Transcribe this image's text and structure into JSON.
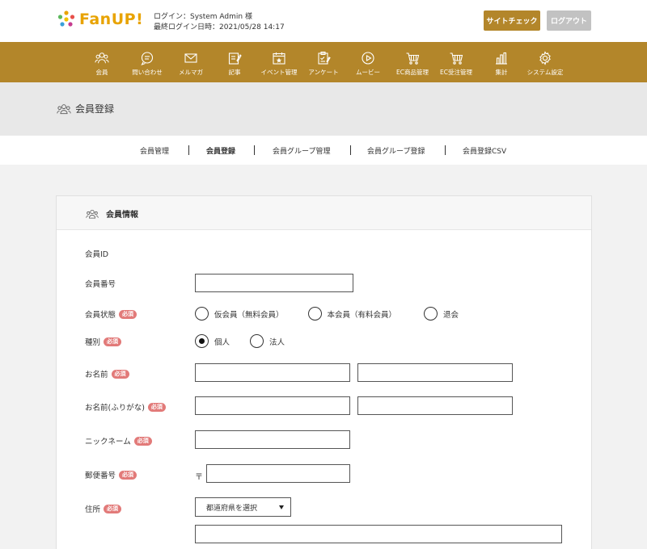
{
  "header": {
    "logo_text": "FanUP!",
    "login_line": "ログイン：System Admin 様",
    "last_login_line": "最終ログイン日時：2021/05/28 14:17",
    "site_check_label": "サイトチェック",
    "logout_label": "ログアウト"
  },
  "nav": {
    "items": [
      {
        "label": "会員",
        "icon": "members-icon"
      },
      {
        "label": "問い合わせ",
        "icon": "chat-icon"
      },
      {
        "label": "メルマガ",
        "icon": "mail-icon"
      },
      {
        "label": "記事",
        "icon": "article-icon"
      },
      {
        "label": "イベント管理",
        "icon": "event-icon"
      },
      {
        "label": "アンケート",
        "icon": "survey-icon"
      },
      {
        "label": "ムービー",
        "icon": "movie-icon"
      },
      {
        "label": "EC商品管理",
        "icon": "cart-icon"
      },
      {
        "label": "EC受注管理",
        "icon": "cart-icon"
      },
      {
        "label": "集計",
        "icon": "bar-chart-icon"
      },
      {
        "label": "システム設定",
        "icon": "gear-icon"
      }
    ]
  },
  "page": {
    "title": "会員登録"
  },
  "subnav": {
    "items": [
      "会員管理",
      "会員登録",
      "会員グループ管理",
      "会員グループ登録",
      "会員登録CSV"
    ],
    "active": "会員登録"
  },
  "form": {
    "section_title": "会員情報",
    "required_badge": "必須",
    "member_id_label": "会員ID",
    "member_number_label": "会員番号",
    "member_status_label": "会員状態",
    "member_status_options": [
      "仮会員（無料会員）",
      "本会員（有料会員）",
      "退会"
    ],
    "type_label": "種別",
    "type_options": [
      "個人",
      "法人"
    ],
    "type_selected": "個人",
    "name_label": "お名前",
    "name_kana_label": "お名前(ふりがな)",
    "nickname_label": "ニックネーム",
    "postal_label": "郵便番号",
    "postal_mark": "〒",
    "address_label": "住所",
    "prefecture_placeholder": "都道府県を選択"
  },
  "colors": {
    "brand": "#b3862a",
    "required": "#e27a79",
    "logout": "#c2c2c2"
  }
}
